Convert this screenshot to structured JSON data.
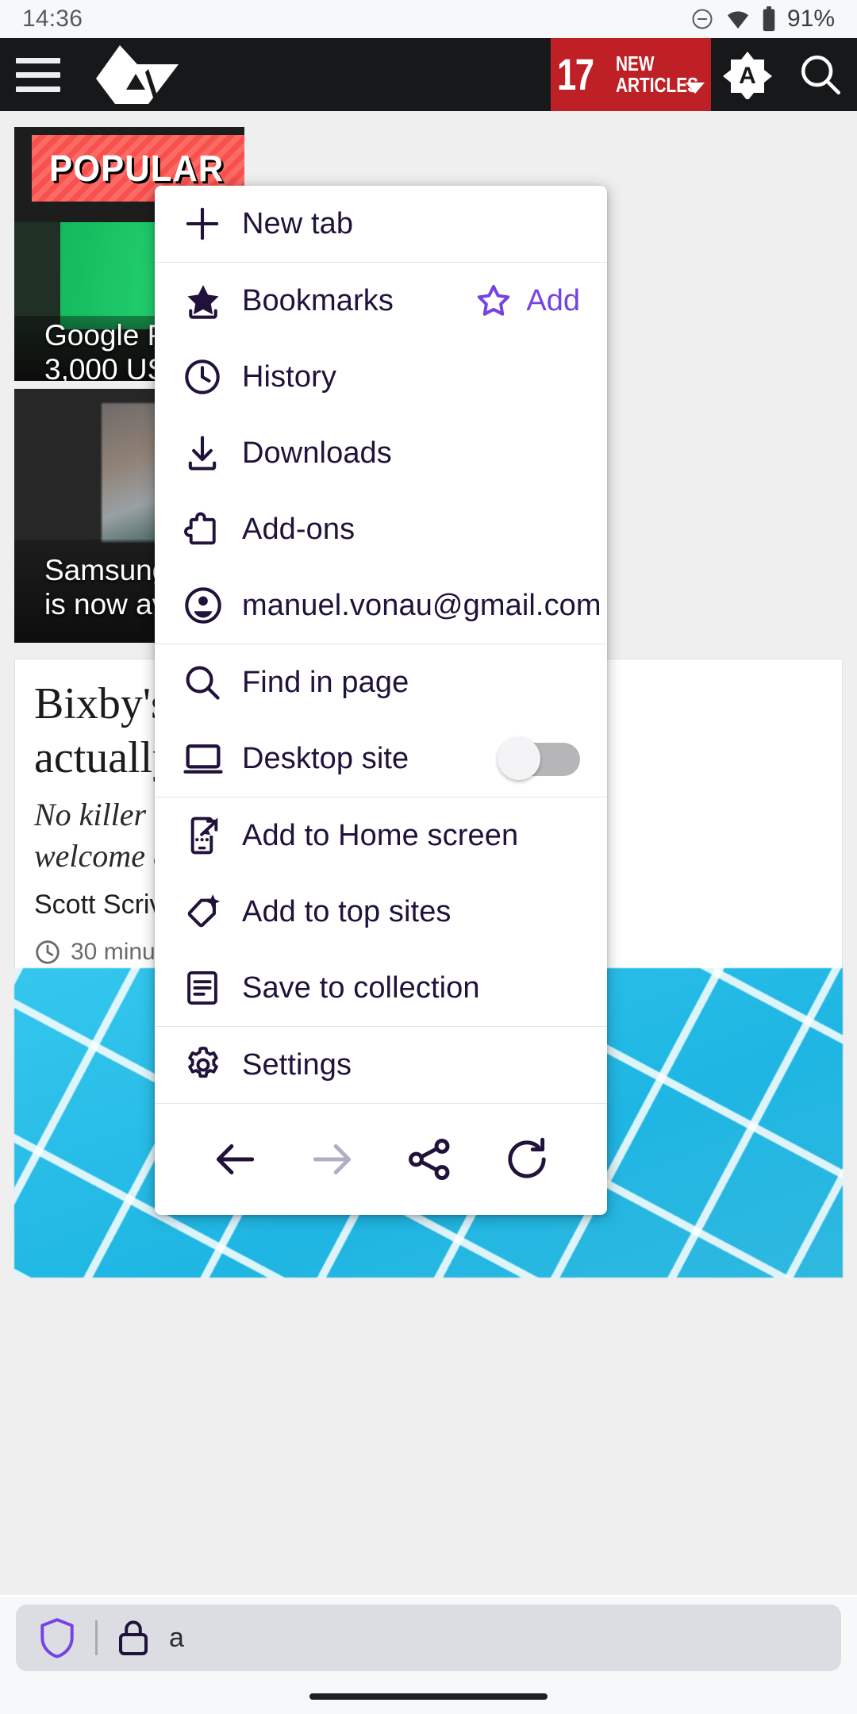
{
  "status_bar": {
    "time": "14:36",
    "battery_percent": "91%",
    "icons": [
      "dnd-icon",
      "wifi-icon",
      "battery-icon"
    ]
  },
  "app_bar": {
    "menu_button": "hamburger-icon",
    "brand": "android-police-logo",
    "new_articles": {
      "count": "17",
      "line1": "NEW",
      "line2": "ARTICLES"
    },
    "account_badge": "A",
    "search": "search-icon"
  },
  "page_content": {
    "popular_tag": "POPULAR",
    "cards": [
      {
        "title": "Google Pay's n\n3,000 US bank"
      },
      {
        "title": "Samsung's Ju\nis now availab"
      }
    ],
    "article": {
      "headline": "Bixby's\nactually",
      "subhead": "No killer n\nwelcome c",
      "author": "Scott Scriv",
      "time": "30 minutes"
    }
  },
  "url_bar": {
    "shield_icon": "shield-icon",
    "lock_icon": "lock-icon",
    "url": "a"
  },
  "menu": {
    "groups": [
      {
        "items": [
          {
            "label": "New tab",
            "icon": "plus-icon",
            "trailing": null
          }
        ]
      },
      {
        "items": [
          {
            "label": "Bookmarks",
            "icon": "star-filled-icon",
            "trailing": {
              "type": "action",
              "label": "Add",
              "icon": "star-outline-icon",
              "color": "#7542e5"
            }
          },
          {
            "label": "History",
            "icon": "clock-icon",
            "trailing": null
          },
          {
            "label": "Downloads",
            "icon": "download-icon",
            "trailing": null
          },
          {
            "label": "Add-ons",
            "icon": "puzzle-icon",
            "trailing": null
          },
          {
            "label": "manuel.vonau@gmail.com",
            "icon": "account-icon",
            "trailing": null
          }
        ]
      },
      {
        "items": [
          {
            "label": "Find in page",
            "icon": "search-icon",
            "trailing": null
          },
          {
            "label": "Desktop site",
            "icon": "desktop-icon",
            "trailing": {
              "type": "toggle",
              "state": "off"
            }
          }
        ]
      },
      {
        "items": [
          {
            "label": "Add to Home screen",
            "icon": "add-to-home-icon",
            "trailing": null
          },
          {
            "label": "Add to top sites",
            "icon": "add-top-sites-icon",
            "trailing": null
          },
          {
            "label": "Save to collection",
            "icon": "collection-icon",
            "trailing": null
          }
        ]
      },
      {
        "items": [
          {
            "label": "Settings",
            "icon": "gear-icon",
            "trailing": null
          }
        ]
      }
    ],
    "nav": [
      {
        "name": "back-icon",
        "enabled": true
      },
      {
        "name": "forward-icon",
        "enabled": false
      },
      {
        "name": "share-icon",
        "enabled": true
      },
      {
        "name": "reload-icon",
        "enabled": true
      }
    ],
    "colors": {
      "text": "#20123a",
      "accent": "#7542e5",
      "disabled": "#b0aec0"
    }
  }
}
